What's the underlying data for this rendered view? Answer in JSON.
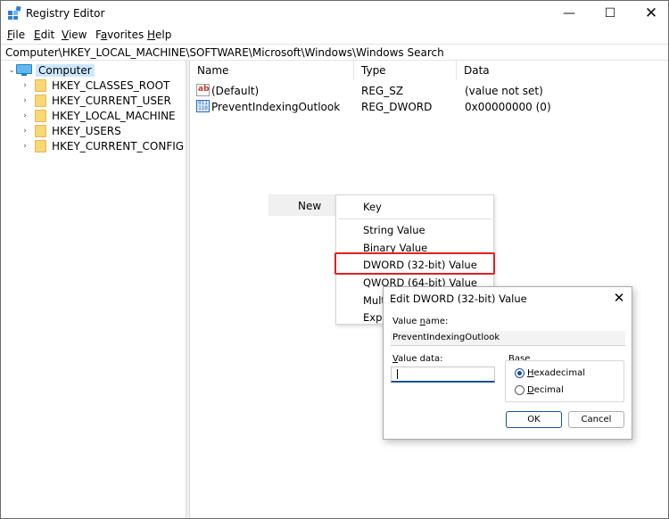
{
  "window": {
    "title": "Registry Editor",
    "controls": {
      "minimize": "—",
      "maximize": "☐",
      "close": "✕"
    }
  },
  "menu": {
    "file": {
      "key": "F",
      "rest": "ile"
    },
    "edit": {
      "key": "E",
      "rest": "dit"
    },
    "view": {
      "key": "V",
      "rest": "iew"
    },
    "favorites": {
      "pre": "F",
      "key": "a",
      "rest": "vorites"
    },
    "help": {
      "key": "H",
      "rest": "elp"
    }
  },
  "address": "Computer\\HKEY_LOCAL_MACHINE\\SOFTWARE\\Microsoft\\Windows\\Windows Search",
  "tree": {
    "root": "Computer",
    "children": [
      "HKEY_CLASSES_ROOT",
      "HKEY_CURRENT_USER",
      "HKEY_LOCAL_MACHINE",
      "HKEY_USERS",
      "HKEY_CURRENT_CONFIG"
    ]
  },
  "list": {
    "columns": {
      "name": "Name",
      "type": "Type",
      "data": "Data"
    },
    "rows": [
      {
        "name": "(Default)",
        "type": "REG_SZ",
        "data": "(value not set)",
        "icon": "string-value-icon"
      },
      {
        "name": "PreventIndexingOutlook",
        "type": "REG_DWORD",
        "data": "0x00000000 (0)",
        "icon": "binary-value-icon"
      }
    ]
  },
  "context_menu": {
    "new_label": "New",
    "submenu": [
      "Key",
      "String Value",
      "Binary Value",
      "DWORD (32-bit) Value",
      "QWORD (64-bit) Value",
      "Multi",
      "Expa"
    ],
    "highlight_color": "#e02020"
  },
  "dialog": {
    "title": "Edit DWORD (32-bit) Value",
    "value_name_label": {
      "pre": "Value ",
      "key": "n",
      "rest": "ame:"
    },
    "value_name": "PreventIndexingOutlook",
    "value_data_label": {
      "key": "V",
      "rest": "alue data:"
    },
    "value_data": "",
    "base_label": "Base",
    "hex": {
      "key": "H",
      "rest": "exadecimal"
    },
    "dec": {
      "key": "D",
      "rest": "ecimal"
    },
    "ok": "OK",
    "cancel": "Cancel"
  },
  "colors": {
    "accent": "#1a4e9c",
    "selection": "#cce8ff",
    "folder": "#f8d775"
  }
}
